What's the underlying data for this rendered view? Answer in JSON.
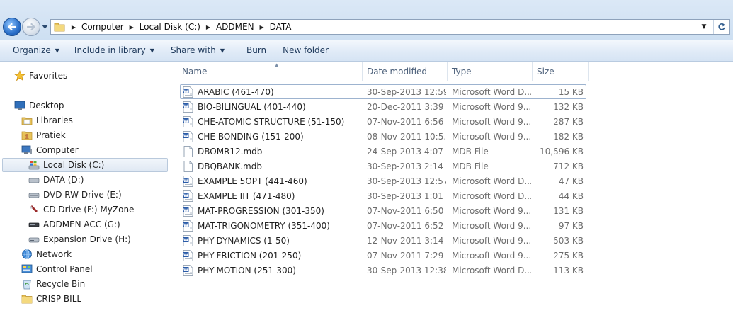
{
  "address": {
    "crumbs": [
      "Computer",
      "Local Disk (C:)",
      "ADDMEN",
      "DATA"
    ]
  },
  "toolbar": {
    "organize": "Organize",
    "include_in_library": "Include in library",
    "share_with": "Share with",
    "burn": "Burn",
    "new_folder": "New folder"
  },
  "nav": {
    "favorites": "Favorites",
    "desktop": "Desktop",
    "libraries": "Libraries",
    "pratiek": "Pratiek",
    "computer": "Computer",
    "local_disk_c": "Local Disk (C:)",
    "data_d": "DATA (D:)",
    "dvd_rw_e": "DVD RW Drive (E:)",
    "cd_drive_f": "CD Drive (F:) MyZone",
    "addmen_acc_g": "ADDMEN ACC (G:)",
    "expansion_h": "Expansion Drive (H:)",
    "network": "Network",
    "control_panel": "Control Panel",
    "recycle_bin": "Recycle Bin",
    "crisp_bill": "CRISP BILL"
  },
  "columns": {
    "name": "Name",
    "date_modified": "Date modified",
    "type": "Type",
    "size": "Size"
  },
  "files": [
    {
      "icon": "word-doc-icon",
      "name": "ARABIC (461-470)",
      "date": "30-Sep-2013 12:59...",
      "type": "Microsoft Word D...",
      "size": "15 KB"
    },
    {
      "icon": "word-doc-icon",
      "name": "BIO-BILINGUAL (401-440)",
      "date": "20-Dec-2011 3:39 ...",
      "type": "Microsoft Word 9...",
      "size": "132 KB"
    },
    {
      "icon": "word-doc-icon",
      "name": "CHE-ATOMIC STRUCTURE (51-150)",
      "date": "07-Nov-2011 6:56 ...",
      "type": "Microsoft Word 9...",
      "size": "287 KB"
    },
    {
      "icon": "word-doc-icon",
      "name": "CHE-BONDING (151-200)",
      "date": "08-Nov-2011 10:5...",
      "type": "Microsoft Word 9...",
      "size": "182 KB"
    },
    {
      "icon": "blank-file-icon",
      "name": "DBOMR12.mdb",
      "date": "24-Sep-2013 4:07 ...",
      "type": "MDB File",
      "size": "10,596 KB"
    },
    {
      "icon": "blank-file-icon",
      "name": "DBQBANK.mdb",
      "date": "30-Sep-2013 2:14 ...",
      "type": "MDB File",
      "size": "712 KB"
    },
    {
      "icon": "word-doc-icon",
      "name": "EXAMPLE 5OPT (441-460)",
      "date": "30-Sep-2013 12:57...",
      "type": "Microsoft Word D...",
      "size": "47 KB"
    },
    {
      "icon": "word-doc-icon",
      "name": "EXAMPLE IIT (471-480)",
      "date": "30-Sep-2013 1:01 ...",
      "type": "Microsoft Word D...",
      "size": "44 KB"
    },
    {
      "icon": "word-doc-icon",
      "name": "MAT-PROGRESSION (301-350)",
      "date": "07-Nov-2011 6:50 ...",
      "type": "Microsoft Word 9...",
      "size": "131 KB"
    },
    {
      "icon": "word-doc-icon",
      "name": "MAT-TRIGONOMETRY (351-400)",
      "date": "07-Nov-2011 6:52 ...",
      "type": "Microsoft Word 9...",
      "size": "97 KB"
    },
    {
      "icon": "word-doc-icon",
      "name": "PHY-DYNAMICS (1-50)",
      "date": "12-Nov-2011 3:14 ...",
      "type": "Microsoft Word 9...",
      "size": "503 KB"
    },
    {
      "icon": "word-doc-icon",
      "name": "PHY-FRICTION (201-250)",
      "date": "07-Nov-2011 7:29 ...",
      "type": "Microsoft Word 9...",
      "size": "275 KB"
    },
    {
      "icon": "word-doc-icon",
      "name": "PHY-MOTION (251-300)",
      "date": "30-Sep-2013 12:38...",
      "type": "Microsoft Word D...",
      "size": "113 KB"
    }
  ]
}
